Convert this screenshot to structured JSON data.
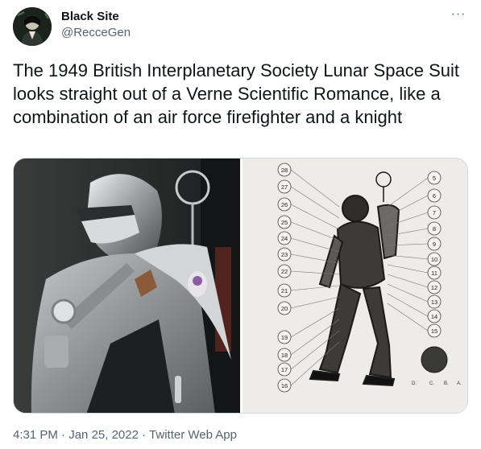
{
  "author": {
    "display_name": "Black Site",
    "handle": "@RecceGen"
  },
  "more_label": "···",
  "tweet": {
    "text": "The 1949 British Interplanetary Society Lunar Space Suit looks straight out of a Verne Scientific Romance, like a combination of an air force firefighter and a knight"
  },
  "diagram_labels": {
    "left_column": [
      "28",
      "27",
      "26",
      "25",
      "24",
      "23",
      "22",
      "21",
      "20",
      "19",
      "18",
      "17",
      "16"
    ],
    "right_column": [
      "5",
      "6",
      "7",
      "8",
      "9",
      "10",
      "11",
      "12",
      "13",
      "14",
      "15"
    ],
    "bottom_letters": [
      "D.",
      "C.",
      "B.",
      "A."
    ]
  },
  "footer": {
    "time": "4:31 PM",
    "separator1": " · ",
    "date": "Jan 25, 2022",
    "separator2": " · ",
    "source": "Twitter Web App"
  }
}
